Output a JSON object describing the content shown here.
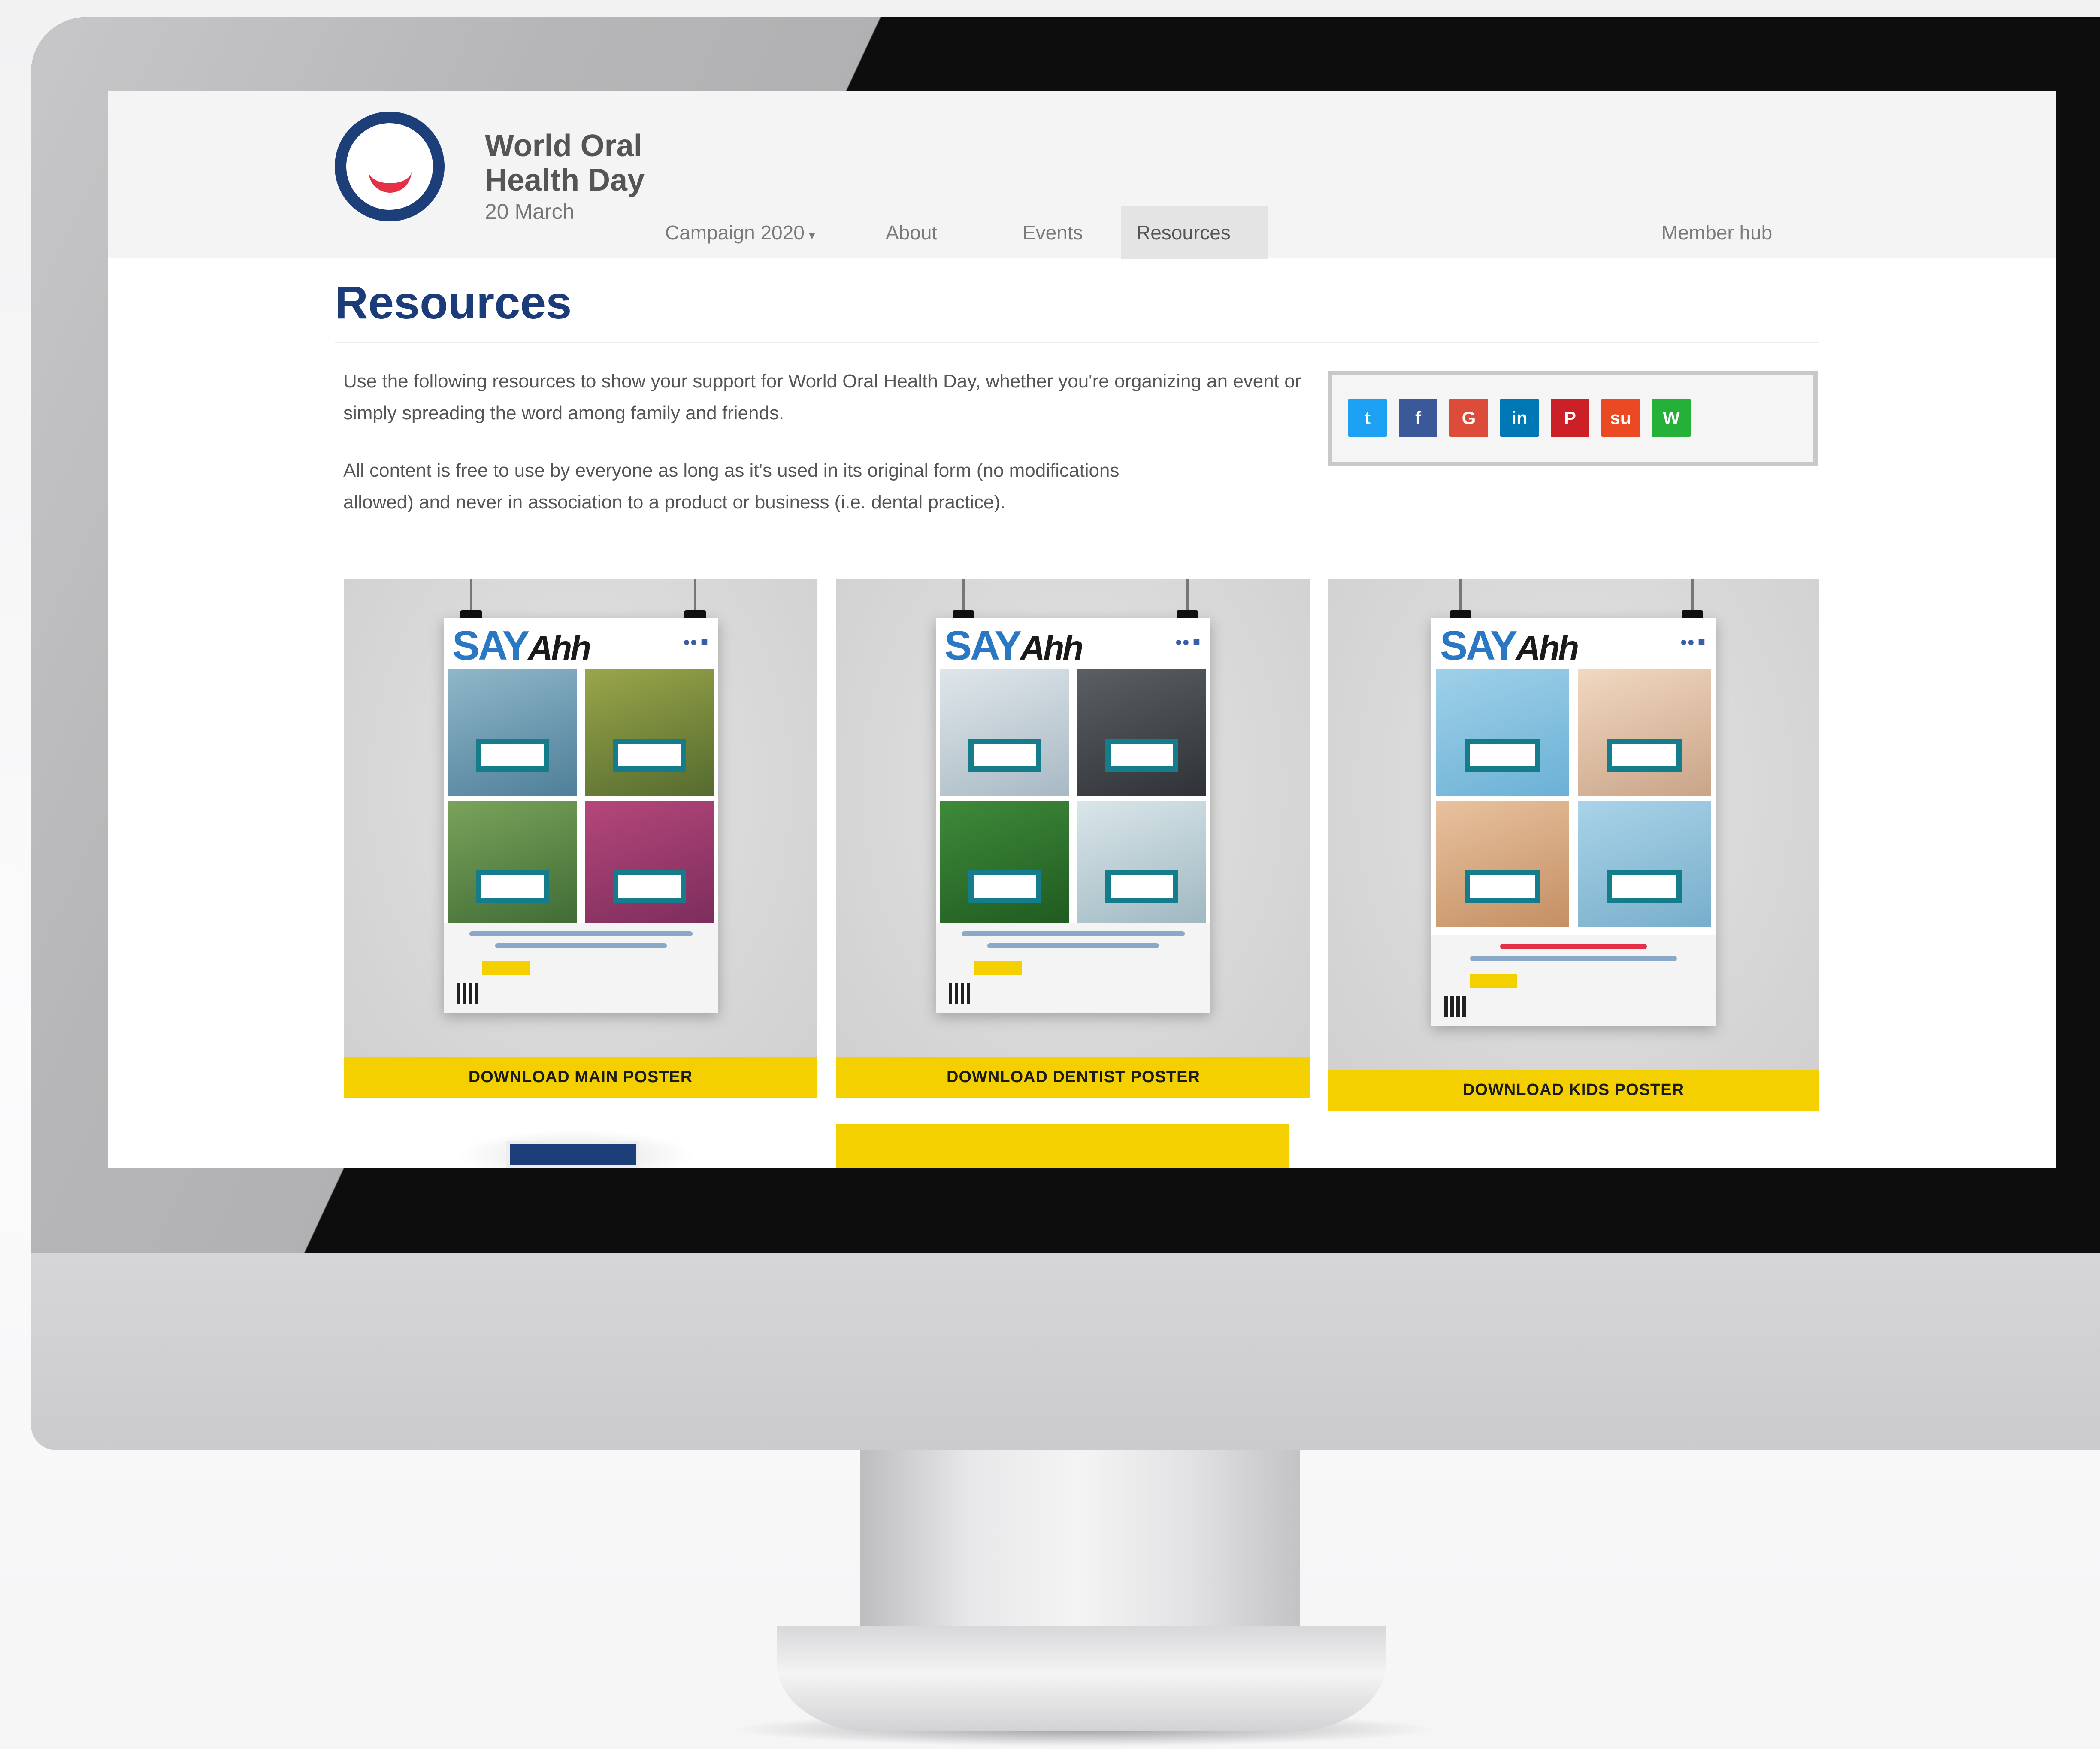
{
  "site": {
    "logo_name": "World Oral Health Day logo",
    "brand_line1": "World Oral",
    "brand_line2": "Health Day",
    "brand_date": "20 March"
  },
  "nav": {
    "campaign": "Campaign 2020",
    "about": "About",
    "events": "Events",
    "resources": "Resources",
    "member_hub": "Member hub"
  },
  "page": {
    "title": "Resources",
    "intro_p1": "Use the following resources to show your support for World Oral Health Day, whether you're organizing an event or simply spreading the word among family and friends.",
    "intro_p2": "All content is free to use by everyone as long as it's used in its original form (no modifications allowed) and never in association to a product or business (i.e. dental practice)."
  },
  "share": {
    "buttons": [
      {
        "icon": "twitter-icon",
        "glyph": "t",
        "color": "#1da1f2"
      },
      {
        "icon": "facebook-icon",
        "glyph": "f",
        "color": "#3b5998"
      },
      {
        "icon": "google-plus-icon",
        "glyph": "G",
        "color": "#dd4b39"
      },
      {
        "icon": "linkedin-icon",
        "glyph": "in",
        "color": "#0077b5"
      },
      {
        "icon": "pinterest-icon",
        "glyph": "P",
        "color": "#cb2027"
      },
      {
        "icon": "stumbleupon-icon",
        "glyph": "su",
        "color": "#eb4924"
      },
      {
        "icon": "whatsapp-icon",
        "glyph": "W",
        "color": "#25b03a"
      }
    ]
  },
  "posters": [
    {
      "say": "SAY",
      "aah": "Ahh",
      "download": "DOWNLOAD MAIN POSTER"
    },
    {
      "say": "SAY",
      "aah": "Ahh",
      "download": "DOWNLOAD DENTIST POSTER"
    },
    {
      "say": "SAY",
      "aah": "Ahh",
      "download": "DOWNLOAD KIDS POSTER"
    }
  ],
  "colors": {
    "brand_blue": "#1b3c78",
    "brand_red": "#e53046",
    "download_yellow": "#f5d000"
  }
}
